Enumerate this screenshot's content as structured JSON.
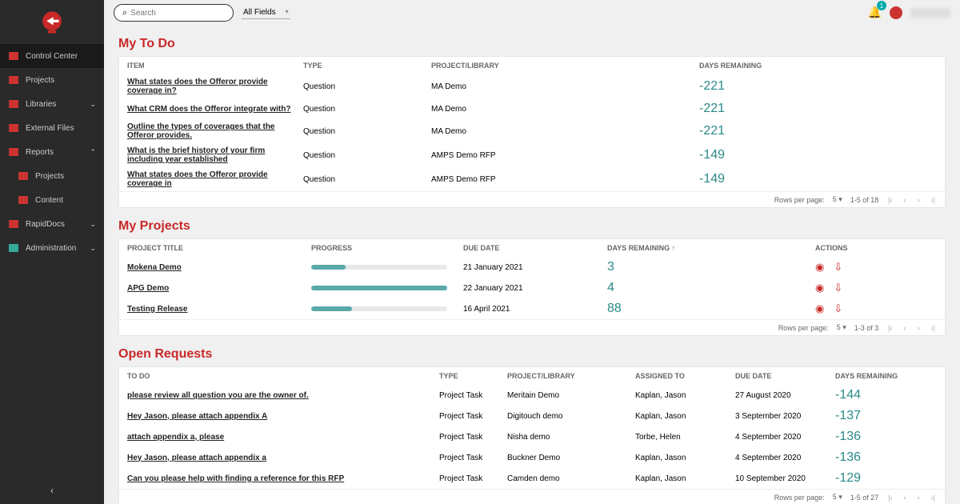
{
  "search": {
    "placeholder": "Search",
    "fields_label": "All Fields"
  },
  "notif_count": "1",
  "sidebar": {
    "items": [
      {
        "label": "Control Center",
        "active": true,
        "chevron": ""
      },
      {
        "label": "Projects",
        "chevron": ""
      },
      {
        "label": "Libraries",
        "chevron": "⌄"
      },
      {
        "label": "External Files",
        "chevron": ""
      },
      {
        "label": "Reports",
        "chevron": "⌃"
      },
      {
        "label": "Projects",
        "sub": true,
        "chevron": ""
      },
      {
        "label": "Content",
        "sub": true,
        "chevron": ""
      },
      {
        "label": "RapidDocs",
        "chevron": "⌄"
      },
      {
        "label": "Administration",
        "chevron": "⌄"
      }
    ]
  },
  "sections": {
    "todo": {
      "title": "My To Do",
      "headers": [
        "ITEM",
        "TYPE",
        "PROJECT/LIBRARY",
        "DAYS REMAINING"
      ],
      "rows": [
        {
          "item": "What states does the Offeror provide coverage in?",
          "type": "Question",
          "proj": "MA Demo",
          "days": "-221"
        },
        {
          "item": "What CRM does the Offeror integrate with?",
          "type": "Question",
          "proj": "MA Demo",
          "days": "-221"
        },
        {
          "item": "Outline the types of coverages that the Offeror provides.",
          "type": "Question",
          "proj": "MA Demo",
          "days": "-221"
        },
        {
          "item": "What is the brief history of your firm including year established",
          "type": "Question",
          "proj": "AMPS Demo RFP",
          "days": "-149"
        },
        {
          "item": "What states does the Offeror provide coverage in",
          "type": "Question",
          "proj": "AMPS Demo RFP",
          "days": "-149"
        }
      ],
      "pager": {
        "rpp_label": "Rows per page:",
        "rpp": "5",
        "range": "1-5 of 18"
      }
    },
    "projects": {
      "title": "My Projects",
      "headers": [
        "PROJECT TITLE",
        "PROGRESS",
        "DUE DATE",
        "DAYS REMAINING ↑",
        "ACTIONS"
      ],
      "rows": [
        {
          "title": "Mokena Demo",
          "progress": 25,
          "due": "21 January 2021",
          "days": "3"
        },
        {
          "title": "APG Demo",
          "progress": 100,
          "due": "22 January 2021",
          "days": "4"
        },
        {
          "title": "Testing Release",
          "progress": 30,
          "due": "16 April 2021",
          "days": "88"
        }
      ],
      "pager": {
        "rpp_label": "Rows per page:",
        "rpp": "5",
        "range": "1-3 of 3"
      }
    },
    "requests": {
      "title": "Open Requests",
      "headers": [
        "TO DO",
        "TYPE",
        "PROJECT/LIBRARY",
        "ASSIGNED TO",
        "DUE DATE",
        "DAYS REMAINING"
      ],
      "rows": [
        {
          "todo": "please review all question you are the owner of.",
          "type": "Project Task",
          "proj": "Meritain Demo",
          "assigned": "Kaplan, Jason",
          "due": "27 August 2020",
          "days": "-144"
        },
        {
          "todo": "Hey Jason, please attach appendix A",
          "type": "Project Task",
          "proj": "Digitouch demo",
          "assigned": "Kaplan, Jason",
          "due": "3 September 2020",
          "days": "-137"
        },
        {
          "todo": "attach appendix a, please",
          "type": "Project Task",
          "proj": "Nisha demo",
          "assigned": "Torbe, Helen",
          "due": "4 September 2020",
          "days": "-136"
        },
        {
          "todo": "Hey Jason, please attach appendix a",
          "type": "Project Task",
          "proj": "Buckner Demo",
          "assigned": "Kaplan, Jason",
          "due": "4 September 2020",
          "days": "-136"
        },
        {
          "todo": "Can you please help with finding a reference for this RFP",
          "type": "Project Task",
          "proj": "Camden demo",
          "assigned": "Kaplan, Jason",
          "due": "10 September 2020",
          "days": "-129"
        }
      ],
      "pager": {
        "rpp_label": "Rows per page:",
        "rpp": "5",
        "range": "1-5 of 27"
      }
    }
  }
}
